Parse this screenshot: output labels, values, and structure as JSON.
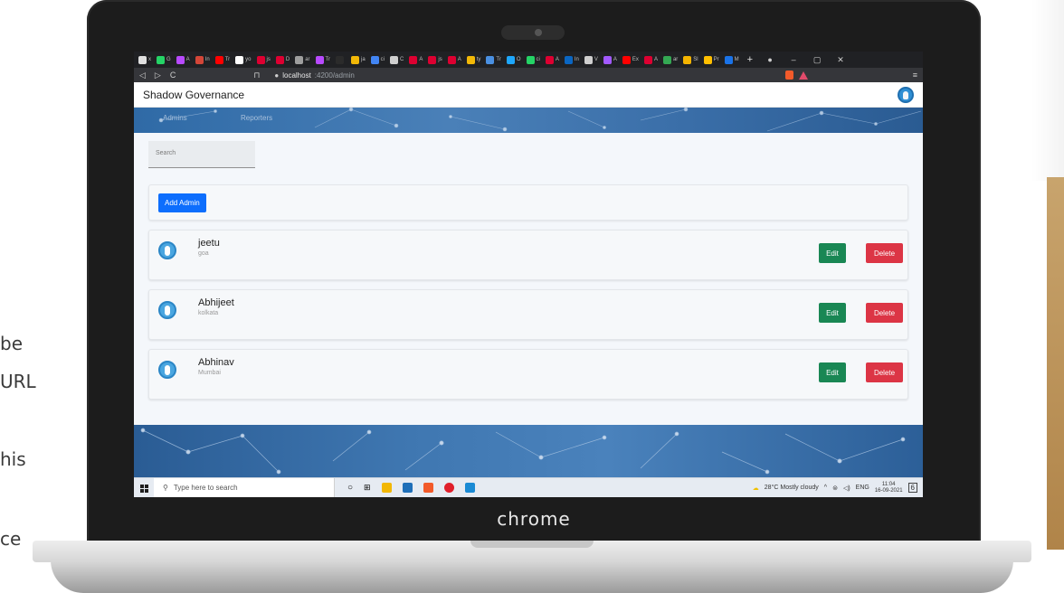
{
  "slide_text": [
    "be",
    "URL",
    "his",
    "ce"
  ],
  "laptop": {
    "brand": "chrome"
  },
  "browser": {
    "url_host": "localhost",
    "url_path": ":4200/admin",
    "new_tab": "+",
    "tabs": [
      {
        "icon": "A",
        "label": "x",
        "color": "#e0e0e0"
      },
      {
        "icon": "G",
        "label": "G",
        "color": "#25d366"
      },
      {
        "icon": ">",
        "label": "A",
        "color": "#b84aff"
      },
      {
        "icon": "M",
        "label": "In",
        "color": "#d44638"
      },
      {
        "icon": "Y",
        "label": "Tr",
        "color": "#ff0000"
      },
      {
        "icon": "gh",
        "label": "yo",
        "color": "#ffffff"
      },
      {
        "icon": "n",
        "label": "js",
        "color": "#dd0031"
      },
      {
        "icon": "A",
        "label": "D",
        "color": "#dd0031"
      },
      {
        "icon": "S",
        "label": "ar",
        "color": "#9e9e9e"
      },
      {
        "icon": ">",
        "label": "Tr",
        "color": "#b84aff"
      },
      {
        "icon": "lc",
        "label": "",
        "color": "#2b2b2b"
      },
      {
        "icon": "d",
        "label": "ja",
        "color": "#f2b807"
      },
      {
        "icon": "G",
        "label": "ci",
        "color": "#4285f4"
      },
      {
        "icon": "o",
        "label": "C",
        "color": "#cfcfcf"
      },
      {
        "icon": "A",
        "label": "A",
        "color": "#dd0031"
      },
      {
        "icon": "n",
        "label": "js",
        "color": "#dd0031"
      },
      {
        "icon": "A",
        "label": "A",
        "color": "#dd0031"
      },
      {
        "icon": "d",
        "label": "ty",
        "color": "#f2b807"
      },
      {
        "icon": "M",
        "label": "Tr",
        "color": "#4a90e2"
      },
      {
        "icon": "o",
        "label": "O",
        "color": "#1ea7fd"
      },
      {
        "icon": "G",
        "label": "ci",
        "color": "#25d366"
      },
      {
        "icon": "A",
        "label": "A",
        "color": "#dd0031"
      },
      {
        "icon": "in",
        "label": "In",
        "color": "#0a66c2"
      },
      {
        "icon": "o",
        "label": "V",
        "color": "#cfcfcf"
      },
      {
        "icon": "x",
        "label": "A",
        "color": "#a259ff"
      },
      {
        "icon": "Y",
        "label": "Ex",
        "color": "#ff0000"
      },
      {
        "icon": "A",
        "label": "A",
        "color": "#dd0031"
      },
      {
        "icon": "d",
        "label": "ar",
        "color": "#34a853"
      },
      {
        "icon": "S",
        "label": "Sl",
        "color": "#f4b400"
      },
      {
        "icon": "P",
        "label": "Pr",
        "color": "#ffbf00"
      },
      {
        "icon": "M",
        "label": "M",
        "color": "#1a73e8"
      }
    ]
  },
  "app": {
    "title": "Shadow Governance",
    "tabs": [
      "Admins",
      "Reporters"
    ],
    "search_placeholder": "Search",
    "add_button": "Add Admin",
    "edit_label": "Edit",
    "delete_label": "Delete",
    "admins": [
      {
        "name": "jeetu",
        "city": "goa"
      },
      {
        "name": "Abhijeet",
        "city": "kolkata"
      },
      {
        "name": "Abhinav",
        "city": "Mumbai"
      }
    ]
  },
  "taskbar": {
    "search_placeholder": "Type here to search",
    "weather": "28°C  Mostly cloudy",
    "language": "ENG",
    "time": "11:04",
    "date": "16-09-2021",
    "notification_count": "6"
  }
}
